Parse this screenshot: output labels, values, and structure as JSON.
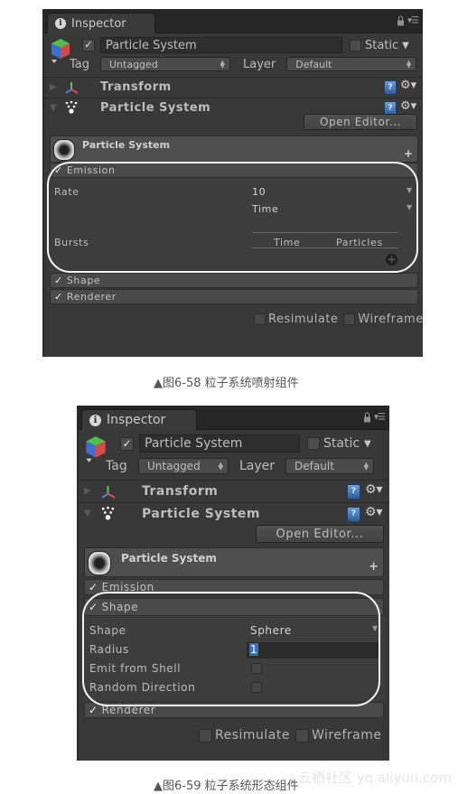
{
  "figures": [
    {
      "inspector": {
        "tab_label": "Inspector",
        "tab_icon": "info-icon",
        "controls": [
          "lock-icon",
          "panel-menu-icon"
        ],
        "gameobject": {
          "active_checked": true,
          "name": "Particle System",
          "static_label": "Static",
          "static_checked": false,
          "tag_label": "Tag",
          "tag_value": "Untagged",
          "layer_label": "Layer",
          "layer_value": "Default"
        },
        "components": [
          {
            "name": "Transform",
            "expanded": false,
            "icon": "transform-axes-icon"
          },
          {
            "name": "Particle System",
            "expanded": true,
            "icon": "particle-system-icon"
          }
        ],
        "open_editor_label": "Open Editor...",
        "ps_title": "Particle System",
        "modules": {
          "emission": {
            "label": "Emission",
            "checked": true
          },
          "shape": {
            "label": "Shape",
            "checked": true
          },
          "renderer": {
            "label": "Renderer",
            "checked": true
          }
        },
        "emission_body": {
          "rate_label": "Rate",
          "rate_value": "10",
          "rate_mode": "Time",
          "bursts_label": "Bursts",
          "bursts_columns": [
            "Time",
            "Particles"
          ]
        },
        "resimulate_label": "Resimulate",
        "wireframe_label": "Wireframe"
      },
      "caption": "▲图6-58 粒子系统喷射组件",
      "highlighted_section": "Emission"
    },
    {
      "inspector": {
        "tab_label": "Inspector",
        "gameobject": {
          "name": "Particle System",
          "static_label": "Static",
          "tag_label": "Tag",
          "tag_value": "Untagged",
          "layer_label": "Layer",
          "layer_value": "Default"
        },
        "components": [
          {
            "name": "Transform",
            "expanded": false
          },
          {
            "name": "Particle System",
            "expanded": true
          }
        ],
        "open_editor_label": "Open Editor...",
        "ps_title": "Particle System",
        "modules": {
          "emission": {
            "label": "Emission",
            "checked": true
          },
          "shape": {
            "label": "Shape",
            "checked": true
          },
          "renderer": {
            "label": "Renderer",
            "checked": true
          }
        },
        "shape_body": {
          "shape_label": "Shape",
          "shape_value": "Sphere",
          "radius_label": "Radius",
          "radius_value": "1",
          "emit_from_shell_label": "Emit from Shell",
          "emit_from_shell_checked": false,
          "random_direction_label": "Random Direction",
          "random_direction_checked": false
        },
        "resimulate_label": "Resimulate",
        "wireframe_label": "Wireframe"
      },
      "caption": "▲图6-59 粒子系统形态组件",
      "highlighted_section": "Shape"
    }
  ],
  "watermark": "云栖社区 yq.aliyun.com",
  "colors": {
    "panel_bg": "#383838",
    "tabbar_bg": "#262626",
    "module_header": "#4a4a4a",
    "help_icon_blue": "#3f77bd",
    "selection_blue": "#3b6fb8",
    "highlight_ring": "#f5f5f5"
  }
}
